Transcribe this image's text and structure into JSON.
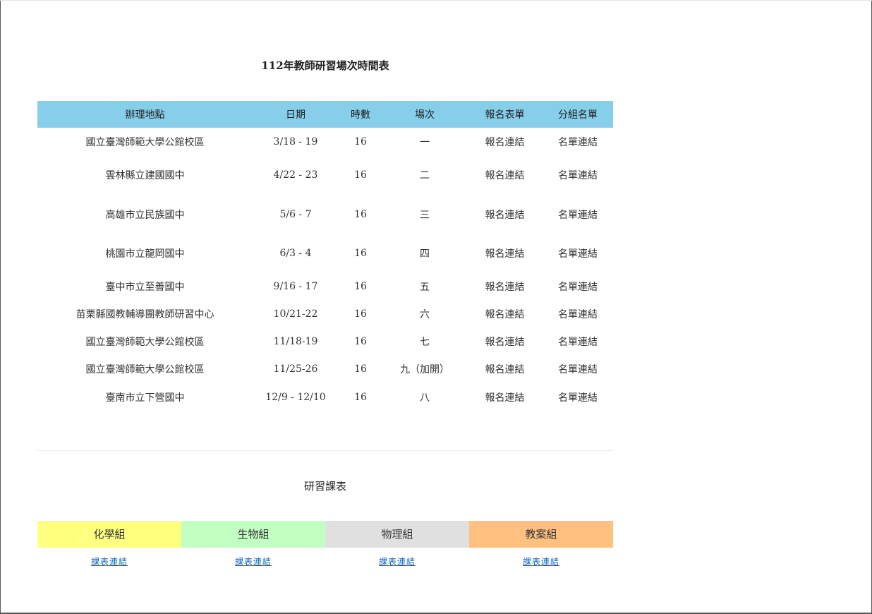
{
  "page": {
    "title": "112年教師研習場次時間表"
  },
  "schedule": {
    "headers": {
      "place": "辦理地點",
      "date": "日期",
      "hours": "時數",
      "session": "場次",
      "registration": "報名表單",
      "group_list": "分組名單"
    },
    "rows": [
      {
        "place": "國立臺灣師範大學公館校區",
        "date": "3/18 - 19",
        "hours": "16",
        "session": "一",
        "registration": "報名連結",
        "group_list": "名單連結"
      },
      {
        "place": "雲林縣立建國國中",
        "date": "4/22 - 23",
        "hours": "16",
        "session": "二",
        "registration": "報名連結",
        "group_list": "名單連結"
      },
      {
        "place": "高雄市立民族國中",
        "date": "5/6 - 7",
        "hours": "16",
        "session": "三",
        "registration": "報名連結",
        "group_list": "名單連結"
      },
      {
        "place": "桃園市立龍岡國中",
        "date": "6/3 - 4",
        "hours": "16",
        "session": "四",
        "registration": "報名連結",
        "group_list": "名單連結"
      },
      {
        "place": "臺中市立至善國中",
        "date": "9/16 - 17",
        "hours": "16",
        "session": "五",
        "registration": "報名連結",
        "group_list": "名單連結"
      },
      {
        "place": "苗栗縣國教輔導團教師研習中心",
        "date": "10/21-22",
        "hours": "16",
        "session": "六",
        "registration": "報名連結",
        "group_list": "名單連結"
      },
      {
        "place": "國立臺灣師範大學公館校區",
        "date": "11/18-19",
        "hours": "16",
        "session": "七",
        "registration": "報名連結",
        "group_list": "名單連結"
      },
      {
        "place": "國立臺灣師範大學公館校區",
        "date": "11/25-26",
        "hours": "16",
        "session": "九（加開）",
        "registration": "報名連結",
        "group_list": "名單連結"
      },
      {
        "place": "臺南市立下營國中",
        "date": "12/9 - 12/10",
        "hours": "16",
        "session": "八",
        "registration": "報名連結",
        "group_list": "名單連結"
      }
    ]
  },
  "courses": {
    "title": "研習課表",
    "groups": [
      {
        "name": "化學組",
        "link": "課表連結",
        "color": "#ffff80"
      },
      {
        "name": "生物組",
        "link": "課表連結",
        "color": "#c2ffc2"
      },
      {
        "name": "物理組",
        "link": "課表連結",
        "color": "#e0e0e0"
      },
      {
        "name": "教案組",
        "link": "課表連結",
        "color": "#ffc080"
      }
    ]
  }
}
